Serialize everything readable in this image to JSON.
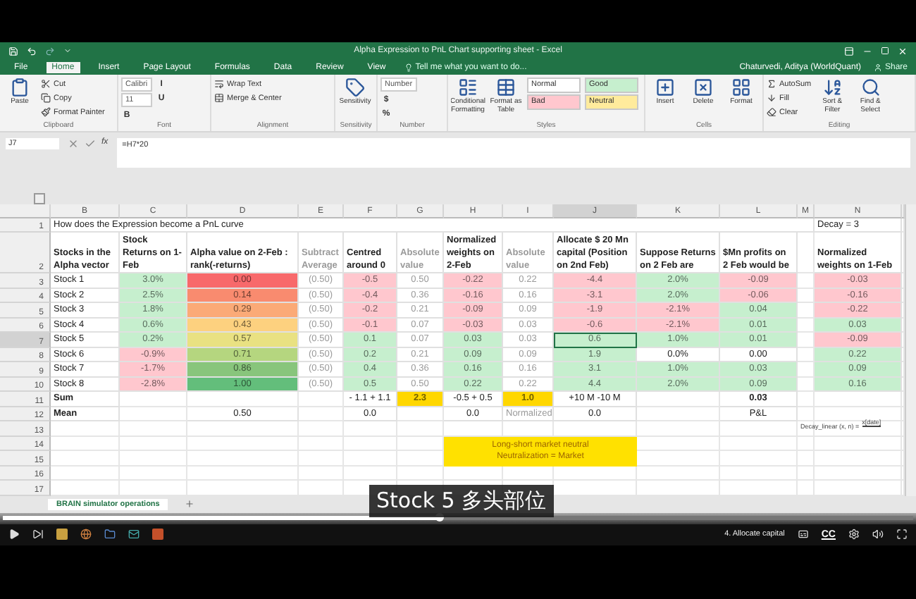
{
  "window": {
    "title": "Alpha Expression to PnL Chart supporting sheet - Excel",
    "user": "Chaturvedi, Aditya (WorldQuant)",
    "share": "Share"
  },
  "tabs": [
    {
      "label": "File",
      "selected": false
    },
    {
      "label": "Home",
      "selected": true
    },
    {
      "label": "Insert",
      "selected": false
    },
    {
      "label": "Page Layout",
      "selected": false
    },
    {
      "label": "Formulas",
      "selected": false
    },
    {
      "label": "Data",
      "selected": false
    },
    {
      "label": "Review",
      "selected": false
    },
    {
      "label": "View",
      "selected": false
    }
  ],
  "tell_me": {
    "placeholder": "Tell me what you want to do..."
  },
  "ribbon": [
    {
      "label": "Clipboard",
      "items": [
        {
          "kind": "large",
          "label": "Paste"
        },
        {
          "kind": "small",
          "label": "Cut"
        },
        {
          "kind": "small",
          "label": "Copy"
        },
        {
          "kind": "small",
          "label": "Format Painter"
        }
      ]
    },
    {
      "label": "Font",
      "items": [
        {
          "kind": "field",
          "label": "Calibri"
        },
        {
          "kind": "field",
          "label": "11"
        },
        {
          "kind": "glyph",
          "label": "B"
        },
        {
          "kind": "glyph",
          "label": "I"
        },
        {
          "kind": "glyph",
          "label": "U"
        }
      ]
    },
    {
      "label": "Alignment",
      "items": [
        {
          "kind": "small",
          "label": "Wrap Text"
        },
        {
          "kind": "small",
          "label": "Merge & Center"
        }
      ]
    },
    {
      "label": "Sensitivity",
      "items": [
        {
          "kind": "large",
          "label": "Sensitivity"
        }
      ]
    },
    {
      "label": "Number",
      "items": [
        {
          "kind": "field",
          "label": "Number"
        },
        {
          "kind": "glyph",
          "label": "$"
        },
        {
          "kind": "glyph",
          "label": "%"
        }
      ]
    },
    {
      "label": "Styles",
      "items": [
        {
          "kind": "large",
          "label": "Conditional Formatting"
        },
        {
          "kind": "large",
          "label": "Format as Table"
        },
        {
          "kind": "style",
          "label": "Normal",
          "color": "#ffffff"
        },
        {
          "kind": "style",
          "label": "Bad",
          "color": "#ffc7ce"
        },
        {
          "kind": "style",
          "label": "Good",
          "color": "#c6efce"
        },
        {
          "kind": "style",
          "label": "Neutral",
          "color": "#ffeb9c"
        }
      ]
    },
    {
      "label": "Cells",
      "items": [
        {
          "kind": "large",
          "label": "Insert"
        },
        {
          "kind": "large",
          "label": "Delete"
        },
        {
          "kind": "large",
          "label": "Format"
        }
      ]
    },
    {
      "label": "Editing",
      "items": [
        {
          "kind": "small",
          "label": "AutoSum"
        },
        {
          "kind": "small",
          "label": "Fill"
        },
        {
          "kind": "small",
          "label": "Clear"
        },
        {
          "kind": "large",
          "label": "Sort & Filter"
        },
        {
          "kind": "large",
          "label": "Find & Select"
        }
      ]
    }
  ],
  "formula_bar": {
    "name_box": "J7",
    "fx": "fx",
    "formula": "=H7*20"
  },
  "sheet": {
    "columns": [
      {
        "letter": "B",
        "selected": false
      },
      {
        "letter": "C",
        "selected": false
      },
      {
        "letter": "D",
        "selected": false
      },
      {
        "letter": "E",
        "muted": true,
        "selected": false
      },
      {
        "letter": "F",
        "selected": false
      },
      {
        "letter": "G",
        "muted": true,
        "selected": false
      },
      {
        "letter": "H",
        "selected": false
      },
      {
        "letter": "I",
        "muted": true,
        "selected": false
      },
      {
        "letter": "J",
        "selected": true
      },
      {
        "letter": "K",
        "selected": false
      },
      {
        "letter": "L",
        "selected": false
      },
      {
        "letter": "M",
        "selected": false
      },
      {
        "letter": "N",
        "selected": false
      }
    ],
    "rows": [
      {
        "num": "1",
        "kind": "title",
        "selected": false,
        "cells": [
          "How does the Expression become a PnL curve",
          null,
          null,
          null,
          null,
          null,
          null,
          null,
          null,
          null,
          null,
          null,
          {
            "text": "Decay = 3"
          }
        ]
      },
      {
        "num": "2",
        "kind": "header",
        "selected": false,
        "cells": [
          {
            "text": "Stocks in the Alpha vector"
          },
          {
            "text": "Stock Returns on 1-Feb"
          },
          {
            "text": "Alpha value on 2-Feb : rank(-returns)"
          },
          {
            "text": "Subtract Average"
          },
          {
            "text": "Centred around 0"
          },
          {
            "text": "Absolute value"
          },
          {
            "text": "Normalized weights on 2-Feb"
          },
          {
            "text": "Absolute value"
          },
          {
            "text": "Allocate $ 20 Mn capital (Position on 2nd Feb)"
          },
          {
            "text": "Suppose Returns on 2 Feb are"
          },
          {
            "text": "$Mn profits on 2 Feb would be"
          },
          null,
          {
            "text": "Normalized weights on 1-Feb"
          }
        ]
      },
      {
        "num": "3",
        "kind": "data",
        "selected": false,
        "cells": [
          {
            "text": "Stock 1"
          },
          {
            "text": "3.0%",
            "color": "#c6efce"
          },
          {
            "text": "0.00",
            "color": "#f8696b"
          },
          {
            "text": "(0.50)"
          },
          {
            "text": "-0.5",
            "color": "#ffc7ce"
          },
          {
            "text": "0.50"
          },
          {
            "text": "-0.22",
            "color": "#ffc7ce"
          },
          {
            "text": "0.22"
          },
          {
            "text": "-4.4",
            "color": "#ffc7ce"
          },
          {
            "text": "2.0%",
            "color": "#c6efce"
          },
          {
            "text": "-0.09",
            "color": "#ffc7ce"
          },
          null,
          {
            "text": "-0.03",
            "color": "#ffc7ce"
          }
        ]
      },
      {
        "num": "4",
        "kind": "data",
        "selected": false,
        "cells": [
          {
            "text": "Stock 2"
          },
          {
            "text": "2.5%",
            "color": "#c6efce"
          },
          {
            "text": "0.14",
            "color": "#f98b6f"
          },
          {
            "text": "(0.50)"
          },
          {
            "text": "-0.4",
            "color": "#ffc7ce"
          },
          {
            "text": "0.36"
          },
          {
            "text": "-0.16",
            "color": "#ffc7ce"
          },
          {
            "text": "0.16"
          },
          {
            "text": "-3.1",
            "color": "#ffc7ce"
          },
          {
            "text": "2.0%",
            "color": "#c6efce"
          },
          {
            "text": "-0.06",
            "color": "#ffc7ce"
          },
          null,
          {
            "text": "-0.16",
            "color": "#ffc7ce"
          }
        ]
      },
      {
        "num": "5",
        "kind": "data",
        "selected": false,
        "cells": [
          {
            "text": "Stock 3"
          },
          {
            "text": "1.8%",
            "color": "#c6efce"
          },
          {
            "text": "0.29",
            "color": "#fbaa77"
          },
          {
            "text": "(0.50)"
          },
          {
            "text": "-0.2",
            "color": "#ffc7ce"
          },
          {
            "text": "0.21"
          },
          {
            "text": "-0.09",
            "color": "#ffc7ce"
          },
          {
            "text": "0.09"
          },
          {
            "text": "-1.9",
            "color": "#ffc7ce"
          },
          {
            "text": "-2.1%",
            "color": "#ffc7ce"
          },
          {
            "text": "0.04",
            "color": "#c6efce"
          },
          null,
          {
            "text": "-0.22",
            "color": "#ffc7ce"
          }
        ]
      },
      {
        "num": "6",
        "kind": "data",
        "selected": false,
        "cells": [
          {
            "text": "Stock 4"
          },
          {
            "text": "0.6%",
            "color": "#c6efce"
          },
          {
            "text": "0.43",
            "color": "#fdd17f"
          },
          {
            "text": "(0.50)"
          },
          {
            "text": "-0.1",
            "color": "#ffc7ce"
          },
          {
            "text": "0.07"
          },
          {
            "text": "-0.03",
            "color": "#ffc7ce"
          },
          {
            "text": "0.03"
          },
          {
            "text": "-0.6",
            "color": "#ffc7ce"
          },
          {
            "text": "-2.1%",
            "color": "#ffc7ce"
          },
          {
            "text": "0.01",
            "color": "#c6efce"
          },
          null,
          {
            "text": "0.03",
            "color": "#c6efce"
          }
        ]
      },
      {
        "num": "7",
        "kind": "data",
        "selected": true,
        "cells": [
          {
            "text": "Stock 5"
          },
          {
            "text": "0.2%",
            "color": "#c6efce"
          },
          {
            "text": "0.57",
            "color": "#e9e182"
          },
          {
            "text": "(0.50)"
          },
          {
            "text": "0.1",
            "color": "#c6efce"
          },
          {
            "text": "0.07"
          },
          {
            "text": "0.03",
            "color": "#c6efce"
          },
          {
            "text": "0.03"
          },
          {
            "text": "0.6",
            "color": "#c6efce"
          },
          {
            "text": "1.0%",
            "color": "#c6efce"
          },
          {
            "text": "0.01",
            "color": "#c6efce"
          },
          null,
          {
            "text": "-0.09",
            "color": "#ffc7ce"
          }
        ]
      },
      {
        "num": "8",
        "kind": "data",
        "selected": false,
        "cells": [
          {
            "text": "Stock 6"
          },
          {
            "text": "-0.9%",
            "color": "#ffc7ce"
          },
          {
            "text": "0.71",
            "color": "#b5d67f"
          },
          {
            "text": "(0.50)"
          },
          {
            "text": "0.2",
            "color": "#c6efce"
          },
          {
            "text": "0.21"
          },
          {
            "text": "0.09",
            "color": "#c6efce"
          },
          {
            "text": "0.09"
          },
          {
            "text": "1.9",
            "color": "#c6efce"
          },
          {
            "text": "0.0%"
          },
          {
            "text": "0.00"
          },
          null,
          {
            "text": "0.22",
            "color": "#c6efce"
          }
        ]
      },
      {
        "num": "9",
        "kind": "data",
        "selected": false,
        "cells": [
          {
            "text": "Stock 7"
          },
          {
            "text": "-1.7%",
            "color": "#ffc7ce"
          },
          {
            "text": "0.86",
            "color": "#88c57c"
          },
          {
            "text": "(0.50)"
          },
          {
            "text": "0.4",
            "color": "#c6efce"
          },
          {
            "text": "0.36"
          },
          {
            "text": "0.16",
            "color": "#c6efce"
          },
          {
            "text": "0.16"
          },
          {
            "text": "3.1",
            "color": "#c6efce"
          },
          {
            "text": "1.0%",
            "color": "#c6efce"
          },
          {
            "text": "0.03",
            "color": "#c6efce"
          },
          null,
          {
            "text": "0.09",
            "color": "#c6efce"
          }
        ]
      },
      {
        "num": "10",
        "kind": "data",
        "selected": false,
        "cells": [
          {
            "text": "Stock 8"
          },
          {
            "text": "-2.8%",
            "color": "#ffc7ce"
          },
          {
            "text": "1.00",
            "color": "#63be7b"
          },
          {
            "text": "(0.50)"
          },
          {
            "text": "0.5",
            "color": "#c6efce"
          },
          {
            "text": "0.50"
          },
          {
            "text": "0.22",
            "color": "#c6efce"
          },
          {
            "text": "0.22"
          },
          {
            "text": "4.4",
            "color": "#c6efce"
          },
          {
            "text": "2.0%",
            "color": "#c6efce"
          },
          {
            "text": "0.09",
            "color": "#c6efce"
          },
          null,
          {
            "text": "0.16",
            "color": "#c6efce"
          }
        ]
      },
      {
        "num": "11",
        "kind": "data",
        "selected": false,
        "cells": [
          {
            "text": "Sum",
            "bold": true
          },
          null,
          null,
          null,
          {
            "text": "- 1.1 + 1.1"
          },
          {
            "text": "2.3",
            "bold": true,
            "color": "#ffd700"
          },
          {
            "text": "-0.5 + 0.5"
          },
          {
            "text": "1.0",
            "bold": true,
            "color": "#ffd700"
          },
          {
            "text": "+10 M -10 M"
          },
          null,
          {
            "text": "0.03",
            "bold": true
          },
          null,
          null
        ]
      },
      {
        "num": "12",
        "kind": "data",
        "selected": false,
        "cells": [
          {
            "text": "Mean",
            "bold": true
          },
          null,
          {
            "text": "0.50"
          },
          null,
          {
            "text": "0.0"
          },
          null,
          {
            "text": "0.0"
          },
          {
            "text": "Normalized"
          },
          {
            "text": "0.0"
          },
          null,
          {
            "text": "P&L"
          },
          null,
          null
        ]
      },
      {
        "num": "13",
        "kind": "empty",
        "selected": false
      },
      {
        "num": "14",
        "kind": "empty",
        "selected": false
      },
      {
        "num": "15",
        "kind": "empty",
        "selected": false
      },
      {
        "num": "16",
        "kind": "empty",
        "selected": false
      },
      {
        "num": "17",
        "kind": "empty",
        "selected": false
      }
    ],
    "callout": [
      "Long-short market neutral",
      "Neutralization = Market"
    ],
    "decay_formula": {
      "lhs": "Decay_linear (x, n) =",
      "numerator": "x[date]"
    },
    "sheet_tabs": [
      {
        "label": "BRAIN simulator operations",
        "selected": true
      }
    ]
  },
  "subtitle": "Stock 5 多头部位",
  "player": {
    "progress": {
      "level": 0.48
    },
    "chapter": "4. Allocate capital",
    "cc": "CC"
  }
}
